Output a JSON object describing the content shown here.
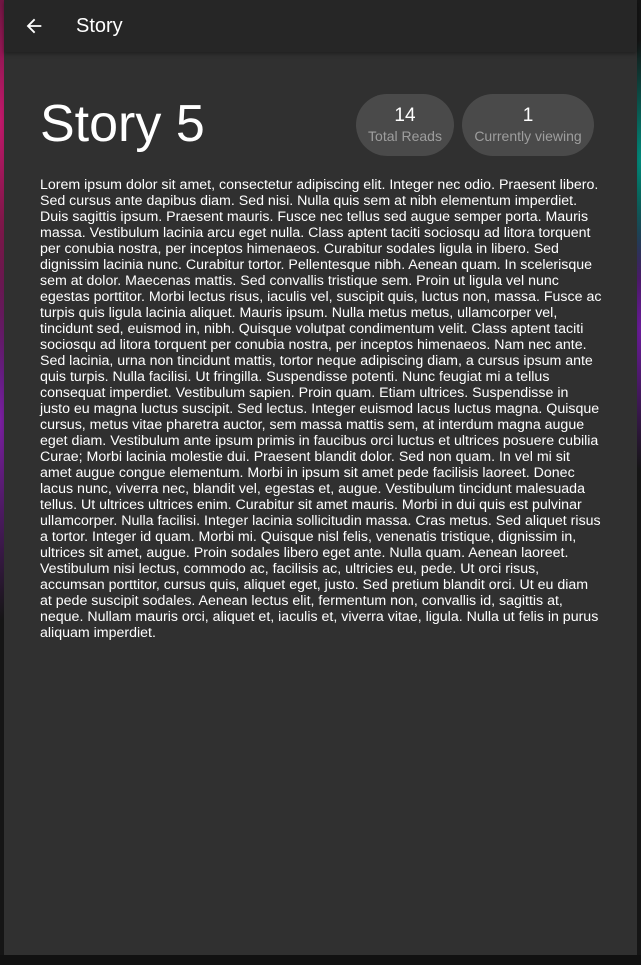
{
  "appbar": {
    "title": "Story",
    "back_icon": "arrow-left-icon"
  },
  "story": {
    "title": "Story 5",
    "stats": {
      "total_reads_value": "14",
      "total_reads_label": "Total Reads",
      "viewing_value": "1",
      "viewing_label": "Currently viewing"
    },
    "body": "Lorem ipsum dolor sit amet, consectetur adipiscing elit. Integer nec odio. Praesent libero. Sed cursus ante dapibus diam. Sed nisi. Nulla quis sem at nibh elementum imperdiet. Duis sagittis ipsum. Praesent mauris. Fusce nec tellus sed augue semper porta. Mauris massa. Vestibulum lacinia arcu eget nulla. Class aptent taciti sociosqu ad litora torquent per conubia nostra, per inceptos himenaeos. Curabitur sodales ligula in libero. Sed dignissim lacinia nunc.   Curabitur tortor. Pellentesque nibh. Aenean quam. In scelerisque sem at dolor. Maecenas mattis. Sed convallis tristique sem. Proin ut ligula vel nunc egestas porttitor. Morbi lectus risus, iaculis vel, suscipit quis, luctus non, massa. Fusce ac turpis quis ligula lacinia aliquet. Mauris ipsum. Nulla metus metus, ullamcorper vel, tincidunt sed, euismod in, nibh. Quisque volutpat condimentum velit. Class aptent taciti sociosqu ad litora torquent per conubia nostra, per inceptos himenaeos. Nam nec ante. Sed lacinia, urna non tincidunt mattis, tortor neque adipiscing diam, a cursus ipsum ante quis turpis. Nulla facilisi. Ut fringilla. Suspendisse potenti. Nunc feugiat mi a tellus consequat imperdiet. Vestibulum sapien. Proin quam. Etiam ultrices. Suspendisse in justo eu magna luctus suscipit. Sed lectus. Integer euismod lacus luctus magna. Quisque cursus, metus vitae pharetra auctor, sem massa mattis sem, at interdum magna augue eget diam. Vestibulum ante ipsum primis in faucibus orci luctus et ultrices posuere cubilia Curae; Morbi lacinia molestie dui.   Praesent blandit dolor. Sed non quam. In vel mi sit amet augue congue elementum. Morbi in ipsum sit amet pede facilisis laoreet. Donec lacus nunc, viverra nec, blandit vel, egestas et, augue. Vestibulum tincidunt malesuada tellus. Ut ultrices ultrices enim. Curabitur sit amet mauris. Morbi in dui quis est pulvinar ullamcorper. Nulla facilisi. Integer lacinia sollicitudin massa. Cras metus. Sed aliquet risus a tortor.   Integer id quam. Morbi mi. Quisque nisl felis, venenatis tristique, dignissim in, ultrices sit amet, augue. Proin sodales libero eget ante. Nulla quam. Aenean laoreet. Vestibulum nisi lectus, commodo ac, facilisis ac, ultricies eu, pede. Ut orci risus, accumsan porttitor, cursus quis, aliquet eget, justo. Sed pretium blandit orci. Ut eu diam at pede suscipit sodales. Aenean lectus elit, fermentum non, convallis id, sagittis at, neque. Nullam mauris orci, aliquet et, iaculis et, viverra vitae, ligula. Nulla ut felis in purus aliquam imperdiet."
  },
  "colors": {
    "card_bg": "#303030",
    "appbar_bg": "#262626",
    "pill_bg": "#4a4a4a",
    "text_primary": "#ffffff",
    "text_secondary": "#9e9e9e"
  }
}
